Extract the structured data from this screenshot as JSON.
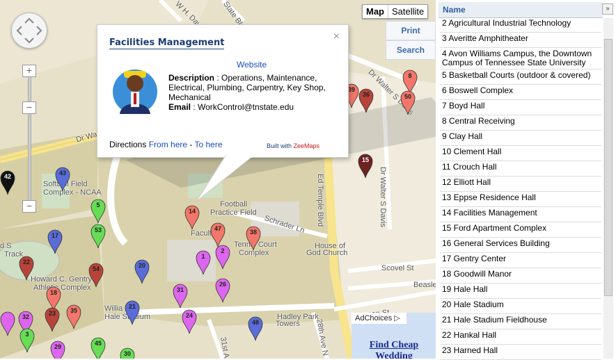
{
  "map": {
    "type_control": {
      "map_label": "Map",
      "satellite_label": "Satellite"
    },
    "print_label": "Print",
    "search_label": "Search",
    "zoom_in": "+",
    "zoom_out": "−",
    "zoom_out2": "−",
    "labels": {
      "dr_wa": "Dr Wa",
      "wh_davis": "W H. Davis",
      "state_blvd": "State Blvd",
      "dr_walter_top": "Dr Walter S Davis",
      "dr_walter_mid": "Dr Walter S Davis",
      "ed_temple": "Ed Temple Blvd",
      "softball_a": "Softball Field",
      "softball_b": "Complex - NCAA",
      "football_a": "Football",
      "football_b": "Practice Field",
      "schrader": "Schrader Ln",
      "tennis_a": "Tennis Court",
      "tennis_b": "Complex",
      "god_a": "House of",
      "god_b": "God Church",
      "scovel": "Scovel St",
      "beasley": "Beasley",
      "track_a": "d S",
      "track_b": "Track",
      "gentry_a": "Howard C. Gentry",
      "gentry_b": "Athletic Complex",
      "hale_a": "Willia",
      "hale_b": "Hale Stadium",
      "hadley_a": "Hadley Park",
      "hadley_b": "Towers",
      "ave28": "28th Ave N",
      "ave31": "31st A",
      "faculty": "Faculty",
      "jefferson": "erson St"
    },
    "markers": [
      {
        "n": "8",
        "color": "#f2766a"
      },
      {
        "n": "39",
        "color": "#f2766a"
      },
      {
        "n": "36",
        "color": "#b8433a"
      },
      {
        "n": "50",
        "color": "#f2766a"
      },
      {
        "n": "15",
        "color": "#6e2222"
      },
      {
        "n": "42",
        "color": "#111111"
      },
      {
        "n": "43",
        "color": "#5a6cd8"
      },
      {
        "n": "5",
        "color": "#66dd55"
      },
      {
        "n": "53",
        "color": "#66dd55"
      },
      {
        "n": "17",
        "color": "#5a6cd8"
      },
      {
        "n": "14",
        "color": "#f2766a"
      },
      {
        "n": "47",
        "color": "#f2766a"
      },
      {
        "n": "38",
        "color": "#f2766a"
      },
      {
        "n": "1",
        "color": "#dd66ee"
      },
      {
        "n": "2",
        "color": "#dd66ee"
      },
      {
        "n": "22",
        "color": "#b8433a"
      },
      {
        "n": "54",
        "color": "#b8433a"
      },
      {
        "n": "20",
        "color": "#5a6cd8"
      },
      {
        "n": "31",
        "color": "#dd66ee"
      },
      {
        "n": "26",
        "color": "#dd66ee"
      },
      {
        "n": "18",
        "color": "#f2766a"
      },
      {
        "n": "23",
        "color": "#b8433a"
      },
      {
        "n": "35",
        "color": "#f2766a"
      },
      {
        "n": "21",
        "color": "#5a6cd8"
      },
      {
        "n": "24",
        "color": "#dd66ee"
      },
      {
        "n": "48",
        "color": "#5a6cd8"
      },
      {
        "n": "32",
        "color": "#dd66ee"
      },
      {
        "n": "3",
        "color": "#66dd55"
      },
      {
        "n": "29",
        "color": "#dd66ee"
      },
      {
        "n": "45",
        "color": "#66dd55"
      },
      {
        "n": "30",
        "color": "#66dd55"
      },
      {
        "n": "",
        "color": "#dd66ee"
      }
    ]
  },
  "info_window": {
    "title": "Facilities Management",
    "website_label": "Website",
    "description_label": "Description",
    "description": " : Operations, Maintenance, Electrical, Plumbing, Carpentry, Key Shop, Mechanical",
    "email_label": "Email",
    "email": " : WorkControl@tnstate.edu",
    "directions_label": "Directions ",
    "from_here": "From here",
    "separator": " - ",
    "to_here": "To here",
    "built_with": "Built with ",
    "brand": "ZeeMaps",
    "close": "×"
  },
  "ad": {
    "adchoices": "AdChoices ▷",
    "link": "Find Cheap Wedding"
  },
  "panel": {
    "header": "Name",
    "expand": "»",
    "items": [
      "2 Agricultural Industrial Technology",
      "3 Averitte Amphitheater",
      "4 Avon Williams Campus, the Downtown Campus of Tennessee State University",
      "5 Basketball Courts (outdoor & covered)",
      "6 Boswell Complex",
      "7 Boyd Hall",
      "8 Central Receiving",
      "9 Clay Hall",
      "10 Clement Hall",
      "11 Crouch Hall",
      "12 Elliott Hall",
      "13 Eppse Residence Hall",
      "14 Facilities Management",
      "15 Ford Apartment Complex",
      "16 General Services Building",
      "17 Gentry Center",
      "18 Goodwill Manor",
      "19 Hale Hall",
      "20 Hale Stadium",
      "21 Hale Stadium Fieldhouse",
      "22 Hankal Hall",
      "23 Harned Hall"
    ]
  }
}
